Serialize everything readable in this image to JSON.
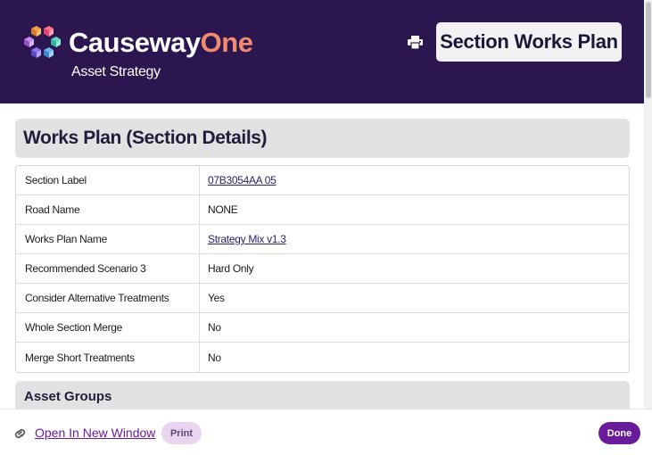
{
  "header": {
    "brand_part1": "Causeway",
    "brand_part2": "One",
    "subbrand": "Asset Strategy",
    "page_title": "Section Works Plan",
    "colors": {
      "background": "#2b1650",
      "brand_accent": "#f08b70"
    },
    "print_icon": "printer-icon",
    "logo": "causeway-cube-logo"
  },
  "main": {
    "section_title": "Works Plan (Section Details)",
    "details": [
      {
        "label": "Section Label",
        "value": "07B3054AA 05",
        "link": true
      },
      {
        "label": "Road Name",
        "value": "NONE",
        "link": false
      },
      {
        "label": "Works Plan Name",
        "value": "Strategy Mix v1.3",
        "link": true
      },
      {
        "label": "Recommended Scenario 3",
        "value": "Hard Only",
        "link": false
      },
      {
        "label": "Consider Alternative Treatments",
        "value": "Yes",
        "link": false
      },
      {
        "label": "Whole Section Merge",
        "value": "No",
        "link": false
      },
      {
        "label": "Merge Short Treatments",
        "value": "No",
        "link": false
      }
    ],
    "next_section_title": "Asset Groups"
  },
  "footer": {
    "open_new_window": "Open In New Window",
    "print_label": "Print",
    "done_label": "Done",
    "link_icon": "link-icon",
    "colors": {
      "accent": "#6a1b9a",
      "print_bg": "#e8d6f0"
    }
  }
}
